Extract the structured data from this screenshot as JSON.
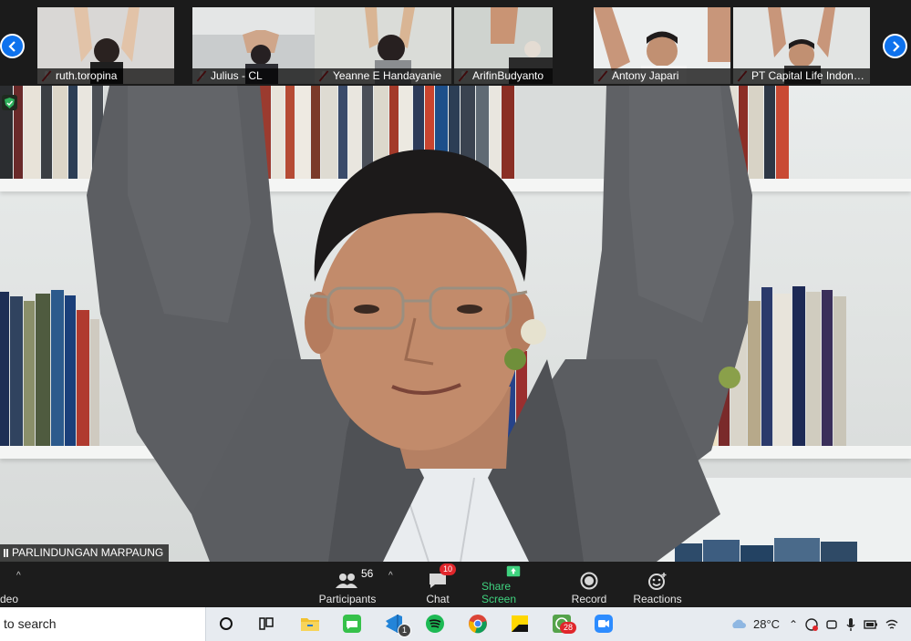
{
  "participants_strip": {
    "tiles": [
      {
        "name": "ruth.toropina",
        "muted": true,
        "bg": "#d9d7d5"
      },
      {
        "name": "Julius - CL",
        "muted": true,
        "bg": "#c9cccd"
      },
      {
        "name": "Yeanne E Handayanie",
        "muted": true,
        "bg": "#dadcd8"
      },
      {
        "name": "ArifinBudyanto",
        "muted": true,
        "bg": "#cfd3cf"
      },
      {
        "name": "Antony Japari",
        "muted": true,
        "bg": "#eceeee"
      },
      {
        "name": "PT Capital Life Indonesia",
        "muted": true,
        "bg": "#e2e4e3"
      }
    ]
  },
  "main_video": {
    "speaker_name": "PARLINDUNGAN MARPAUNG"
  },
  "toolbar": {
    "left_label": "deo",
    "participants_label": "Participants",
    "participants_count": "56",
    "chat_label": "Chat",
    "chat_badge": "10",
    "share_label": "Share Screen",
    "record_label": "Record",
    "reactions_label": "Reactions"
  },
  "taskbar": {
    "search_placeholder": "to search",
    "temperature": "28°C",
    "whatsapp_badge": "28",
    "vscode_badge": "1"
  },
  "colors": {
    "zoom_blue": "#0e72ed",
    "share_green": "#3fd37f",
    "badge_red": "#e0262b",
    "mute_red": "#e0262b"
  }
}
